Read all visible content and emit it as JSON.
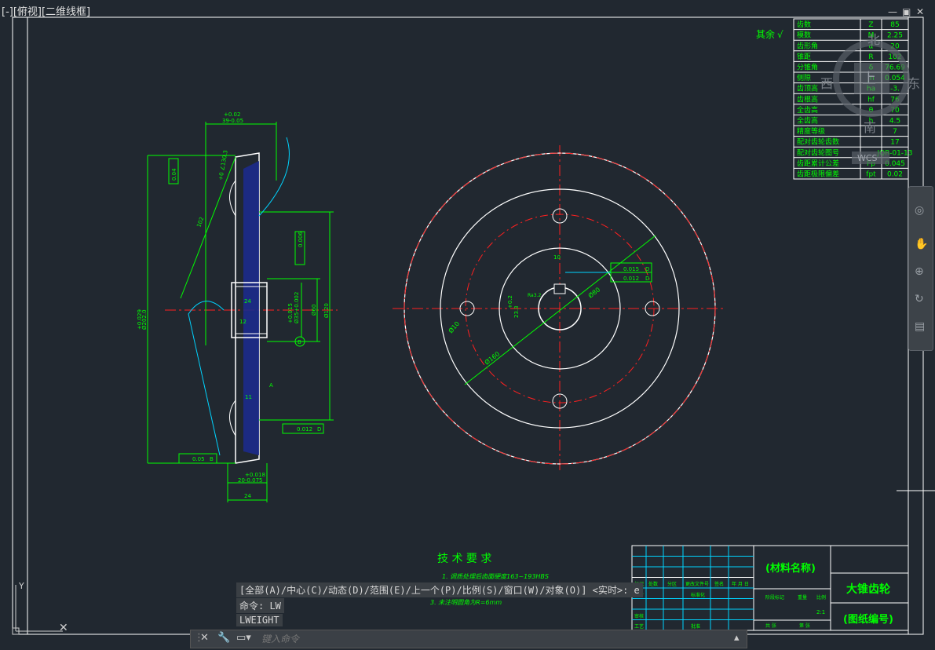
{
  "viewport": {
    "label": "[-][俯视][二维线框]"
  },
  "window_controls": {
    "minimize": "—",
    "restore": "▣",
    "close": "✕"
  },
  "viewcube": {
    "north": "北",
    "west": "西",
    "east": "东",
    "south": "南",
    "top": "上",
    "wcs": "WCS"
  },
  "spec_table": {
    "rows": [
      [
        "齿数",
        "Z",
        "85"
      ],
      [
        "模数",
        "M",
        "2.25"
      ],
      [
        "齿形角",
        "α",
        "20"
      ],
      [
        "锥距",
        "R",
        "102"
      ],
      [
        "分锥角",
        "δ",
        "76.69"
      ],
      [
        "侧隙",
        "jn",
        "0.054"
      ],
      [
        "齿顶高",
        "ha",
        "-3."
      ],
      [
        "齿根高",
        "hf",
        "76"
      ],
      [
        "全齿高",
        "θ",
        "70"
      ],
      [
        "全齿高",
        "h",
        "4.5"
      ],
      [
        "精度等级",
        "",
        "7"
      ],
      [
        "配对齿轮齿数",
        "",
        "17"
      ],
      [
        "配对齿轮图号",
        "",
        "JQR-01-13"
      ],
      [
        "齿距累计公差",
        "Fp",
        "0.045"
      ],
      [
        "齿距极限偏差",
        "fpt",
        "0.02"
      ]
    ]
  },
  "roughness_note": "其余",
  "side_view": {
    "dims": {
      "top_tol": "+0.02",
      "top_width": "39-0.05",
      "tol_box_1": "0.04",
      "tol_box_2": "0.006",
      "angle_top": "+0 ∠130.3",
      "slant": "102",
      "left_tol": "+0.029",
      "left_dia": "Ø202.0",
      "hub_24": "24",
      "hub_12": "12",
      "hole_tol": "+0.015",
      "hole_dia": "Ø35+0.002",
      "d60": "Ø60",
      "d120": "Ø120",
      "datum_b": "B",
      "datum_a": "A",
      "tol_flat": "0.012",
      "tol_flat_d": "D",
      "tol_bottom": "0.05",
      "tol_bottom_b": "B",
      "bot_tol": "+0.018",
      "bot_width": "20-0.075",
      "bot_24": "24",
      "r11": "11"
    }
  },
  "front_view": {
    "dims": {
      "d10": "Ø10",
      "d160": "Ø160",
      "d80": "Ø80",
      "key": "23.3",
      "key_tol": "+0.2",
      "key_w": "10",
      "tol1": "0.015",
      "tol1_d": "D",
      "tol2": "0.012",
      "tol2_d": "D",
      "ra": "Ra3.2"
    }
  },
  "tech_requirements": {
    "title": "技 术 要 求",
    "items": [
      "1. 调质处理后齿面硬度163~193HBS",
      "3. 未注明圆角为R=6mm"
    ]
  },
  "title_block": {
    "material": "(材料名称)",
    "part_name": "大锥齿轮",
    "drawing_no": "(图纸编号)",
    "labels": [
      "标记",
      "处数",
      "分区",
      "更改文件号",
      "签名",
      "年 月 日",
      "设计",
      "标准化",
      "审核",
      "工艺",
      "批准",
      "阶段标记",
      "重量",
      "比例",
      "共 张",
      "第 张"
    ],
    "scale": "2:1"
  },
  "command_history": [
    "[全部(A)/中心(C)/动态(D)/范围(E)/上一个(P)/比例(S)/窗口(W)/对象(O)] <实时>: e",
    "命令: LW",
    "LWEIGHT"
  ],
  "command_line": {
    "placeholder": "键入命令"
  },
  "colors": {
    "bg": "#212830",
    "green": "#00ff00",
    "red": "#ff2020",
    "cyan": "#00d4ff",
    "white": "#ffffff",
    "blue": "#2030a0"
  }
}
